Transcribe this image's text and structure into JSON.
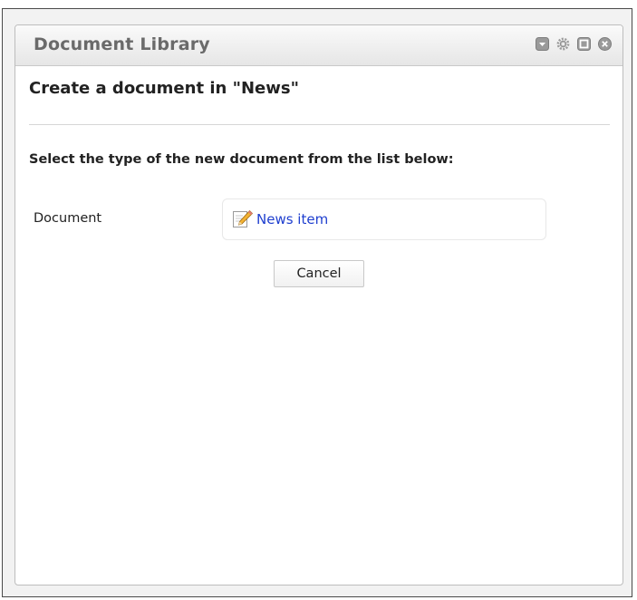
{
  "portlet": {
    "title": "Document Library",
    "icons": [
      "minimize-icon",
      "configure-icon",
      "maximize-icon",
      "close-icon"
    ]
  },
  "dialog": {
    "heading": "Create a document in \"News\"",
    "instructions": "Select the type of the new document from the list below:",
    "types": [
      {
        "label": "Document",
        "link_text": "News item",
        "icon": "edit-document-icon"
      }
    ],
    "cancel_label": "Cancel"
  },
  "colors": {
    "link": "#1f3fcf",
    "title": "#6a6a6a",
    "border": "#bdbdbd"
  }
}
